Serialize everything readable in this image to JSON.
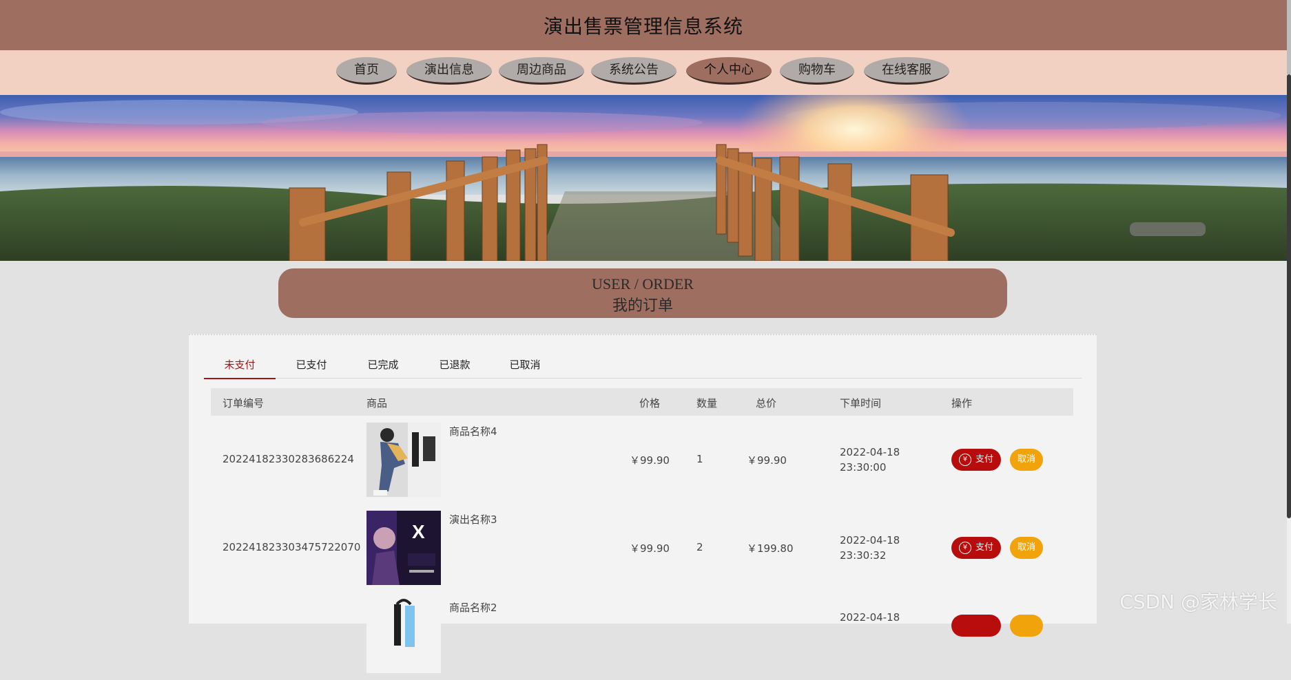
{
  "header": {
    "title": "演出售票管理信息系统"
  },
  "nav": {
    "items": [
      {
        "label": "首页",
        "active": false
      },
      {
        "label": "演出信息",
        "active": false
      },
      {
        "label": "周边商品",
        "active": false
      },
      {
        "label": "系统公告",
        "active": false
      },
      {
        "label": "个人中心",
        "active": true
      },
      {
        "label": "购物车",
        "active": false
      },
      {
        "label": "在线客服",
        "active": false
      }
    ]
  },
  "banner": {
    "slide_count": 3,
    "active_slide": 1
  },
  "section": {
    "title_en": "USER / ORDER",
    "title_cn": "我的订单"
  },
  "tabs": [
    {
      "label": "未支付",
      "active": true
    },
    {
      "label": "已支付",
      "active": false
    },
    {
      "label": "已完成",
      "active": false
    },
    {
      "label": "已退款",
      "active": false
    },
    {
      "label": "已取消",
      "active": false
    }
  ],
  "table": {
    "columns": [
      "订单编号",
      "商品",
      "价格",
      "数量",
      "总价",
      "下单时间",
      "操作"
    ],
    "rows": [
      {
        "order_no": "20224182330283686224",
        "product": "商品名称4",
        "price": "￥99.90",
        "qty": "1",
        "total": "￥99.90",
        "date": "2022-04-18",
        "time": "23:30:00"
      },
      {
        "order_no": "20224182330347572207​0",
        "product": "演出名称3",
        "price": "￥99.90",
        "qty": "2",
        "total": "￥199.80",
        "date": "2022-04-18",
        "time": "23:30:32"
      },
      {
        "order_no": "",
        "product": "商品名称2",
        "price": "",
        "qty": "",
        "total": "",
        "date": "2022-04-18",
        "time": ""
      }
    ],
    "actions": {
      "pay": "支付",
      "cancel": "取消",
      "yen_symbol": "¥"
    }
  },
  "watermark": "CSDN @家林学长",
  "colors": {
    "brand_brown": "#9e6f60",
    "nav_bg": "#f2d0c2",
    "pay_red": "#b80d0d",
    "cancel_orange": "#f0a30a",
    "tab_active": "#a01515"
  }
}
